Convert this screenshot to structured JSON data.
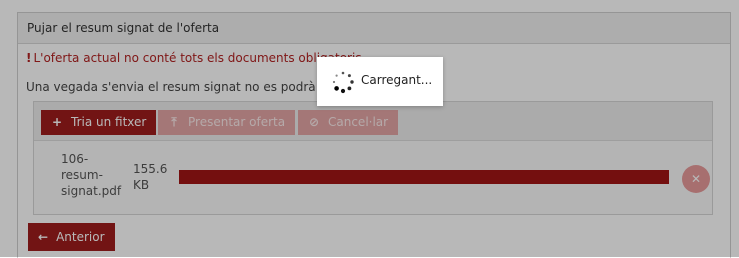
{
  "panel": {
    "heading": "Pujar el resum signat de l'oferta",
    "warning_mark": "!",
    "warning_text": "L'oferta actual no conté tots els documents obligatoris",
    "info_text": "Una vegada s'envia el resum signat no es podrà tornar a pujar"
  },
  "uploader": {
    "choose_file_label": "Tria un fitxer",
    "submit_offer_label": "Presentar oferta",
    "cancel_label": "Cancel·lar",
    "icons": {
      "choose": "plus-icon",
      "submit": "upload-icon",
      "cancel": "cancel-circle-icon",
      "remove": "close-icon"
    },
    "file": {
      "name": "106-resum-signat.pdf",
      "size": "155.6 KB",
      "progress_percent": 100
    }
  },
  "footer": {
    "back_label": "Anterior",
    "back_icon": "arrow-left-icon"
  },
  "loading": {
    "text": "Carregant..."
  },
  "colors": {
    "primary": "#9e1c1c",
    "primary_disabled": "#e4a6a6",
    "warning": "#b22222",
    "progress": "#a11616"
  }
}
